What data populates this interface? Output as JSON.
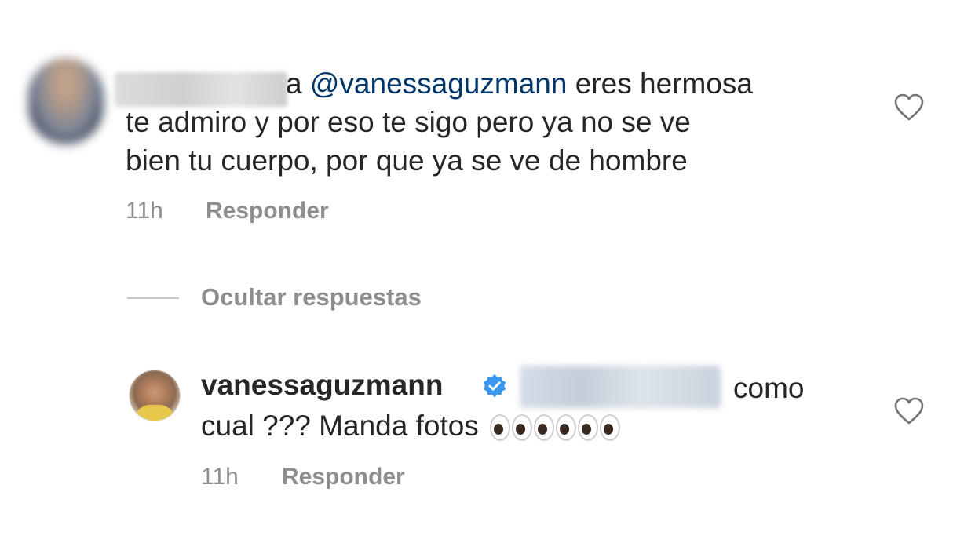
{
  "comment1": {
    "text_after_name": "a",
    "mention": "@vanessaguzmann",
    "text_line1_end": " eres hermosa",
    "text_line2": "te admiro y por eso te sigo pero ya no se ve",
    "text_line3": "bien tu cuerpo, por que ya se ve de hombre",
    "time": "11h",
    "reply_label": "Responder",
    "like_icon": "heart-outline-icon"
  },
  "hide_replies": {
    "label": "Ocultar respuestas"
  },
  "comment2": {
    "username": "vanessaguzmann",
    "verified_icon": "verified-badge-icon",
    "text_line1_end": "como",
    "text_line2": "cual ??? Manda fotos",
    "emoji": "eyes-emoji x3",
    "time": "11h",
    "reply_label": "Responder",
    "like_icon": "heart-outline-icon"
  },
  "colors": {
    "text": "#262626",
    "secondary": "#8e8e8e",
    "mention": "#00376b",
    "verified": "#3897f0"
  }
}
